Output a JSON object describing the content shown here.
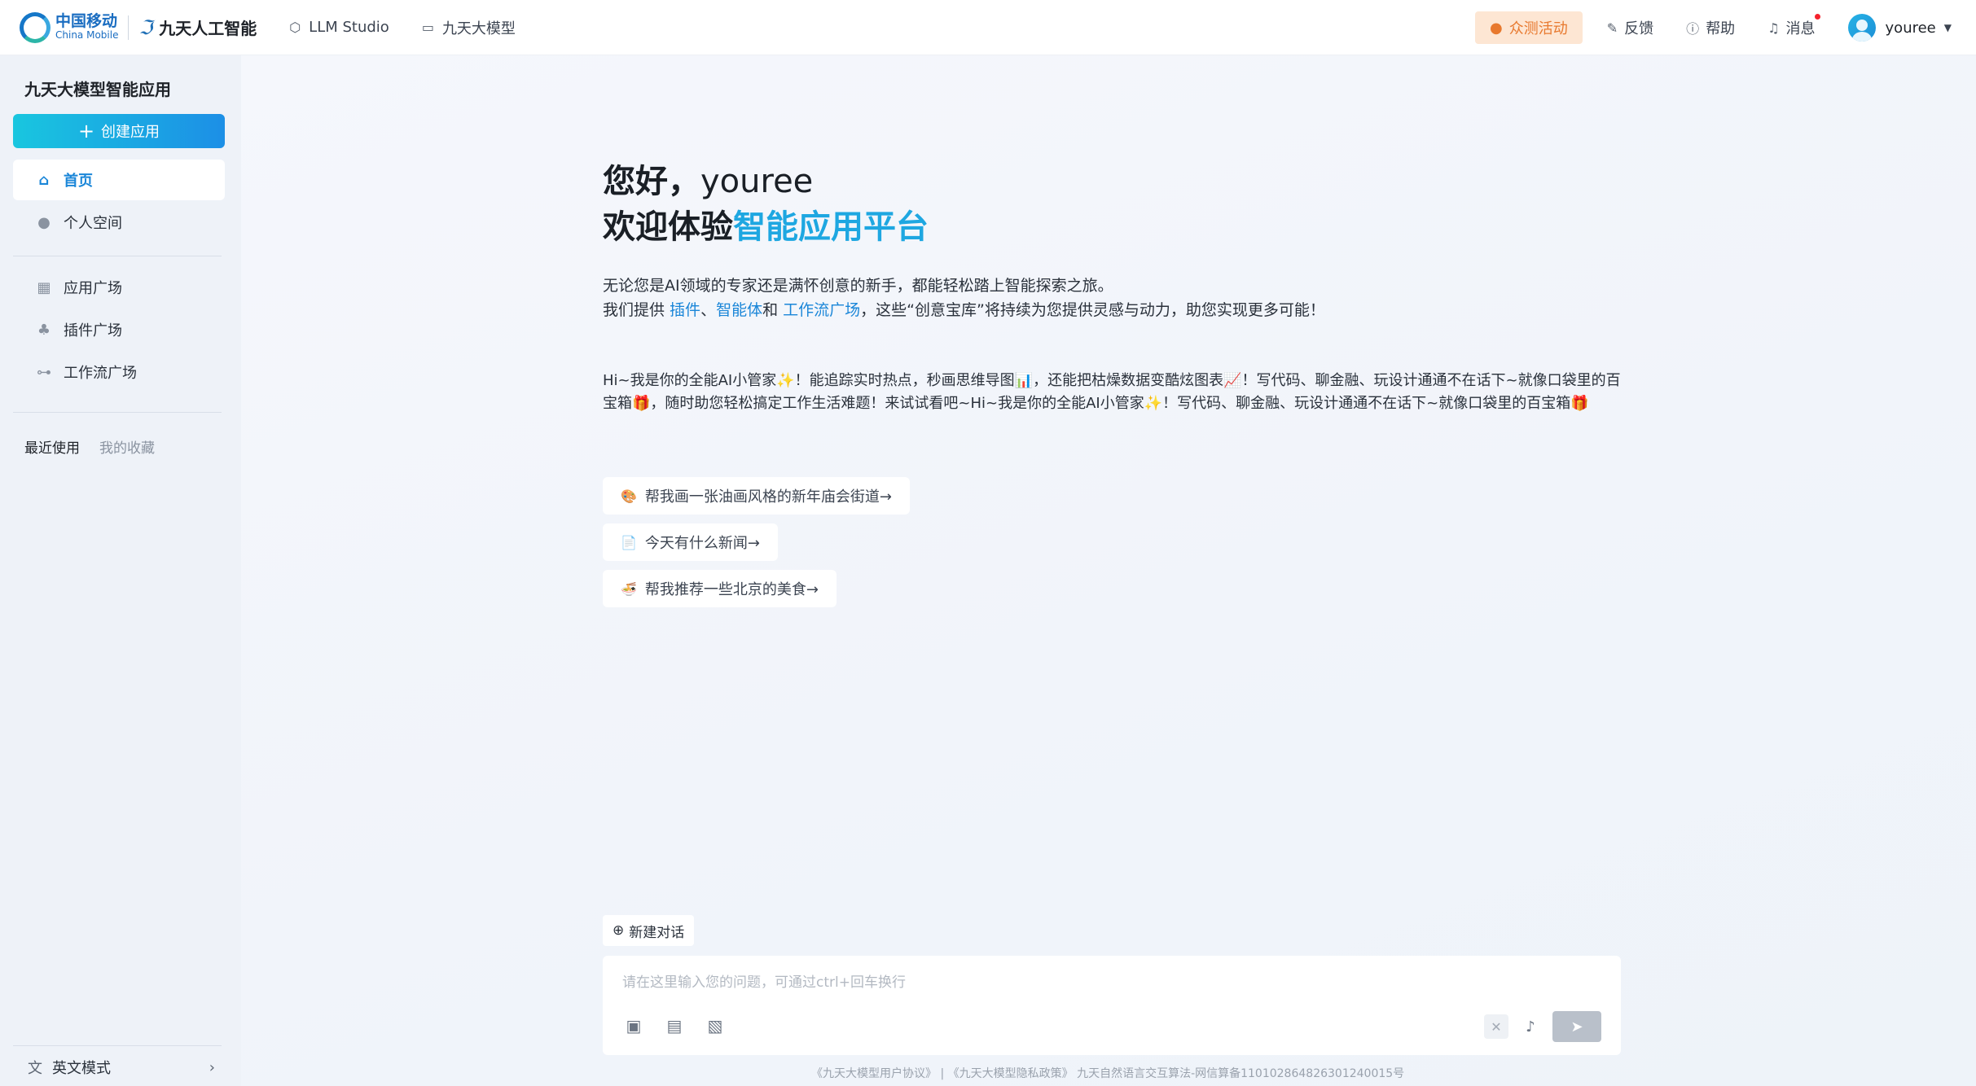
{
  "header": {
    "brand_cn": "中国移动",
    "brand_en": "China Mobile",
    "product_name": "九天人工智能",
    "nav": [
      {
        "label": "LLM Studio",
        "icon": "cube-icon"
      },
      {
        "label": "九天大模型",
        "icon": "monitor-icon"
      }
    ],
    "event_label": "众测活动",
    "feedback_label": "反馈",
    "help_label": "帮助",
    "message_label": "消息",
    "username": "youree"
  },
  "sidebar": {
    "title": "九天大模型智能应用",
    "create_label": "创建应用",
    "items": [
      {
        "label": "首页",
        "icon": "home-icon",
        "active": true
      },
      {
        "label": "个人空间",
        "icon": "user-icon"
      },
      {
        "label": "应用广场",
        "icon": "grid-icon"
      },
      {
        "label": "插件广场",
        "icon": "plugin-icon"
      },
      {
        "label": "工作流广场",
        "icon": "workflow-icon"
      }
    ],
    "tabs": {
      "recent": "最近使用",
      "favorites": "我的收藏"
    },
    "mode_label": "英文模式"
  },
  "main": {
    "greeting_prefix": "您好，",
    "greeting_name": "youree",
    "welcome_prefix": "欢迎体验",
    "welcome_highlight": "智能应用平台",
    "intro_line1": "无论您是AI领域的专家还是满怀创意的新手，都能轻松踏上智能探索之旅。",
    "intro_l2_a": "我们提供 ",
    "intro_link1": "插件",
    "intro_l2_b": "、",
    "intro_link2": "智能体",
    "intro_l2_c": "和 ",
    "intro_link3": "工作流广场",
    "intro_l2_d": "，这些“创意宝库”将持续为您提供灵感与动力，助您实现更多可能！",
    "assistant_p1": "Hi~我是你的全能AI小管家",
    "assistant_p2": "！能追踪实时热点，秒画思维导图",
    "assistant_p3": "，还能把枯燥数据变酷炫图表",
    "assistant_p4": "！写代码、聊金融、玩设计通通不在话下~就像口袋里的百宝箱",
    "assistant_p5": "，随时助您轻松搞定工作生活难题！来试试看吧~Hi~我是你的全能AI小管家",
    "assistant_p6": "！写代码、聊金融、玩设计通通不在话下~就像口袋里的百宝箱",
    "suggestions": [
      "帮我画一张油画风格的新年庙会街道→",
      "今天有什么新闻→",
      "帮我推荐一些北京的美食→"
    ],
    "new_chat_label": "新建对话",
    "input_placeholder": "请在这里输入您的问题，可通过ctrl+回车换行",
    "footer": "《九天大模型用户协议》 | 《九天大模型隐私政策》 九天自然语言交互算法-网信算备110102864826301240015号"
  }
}
